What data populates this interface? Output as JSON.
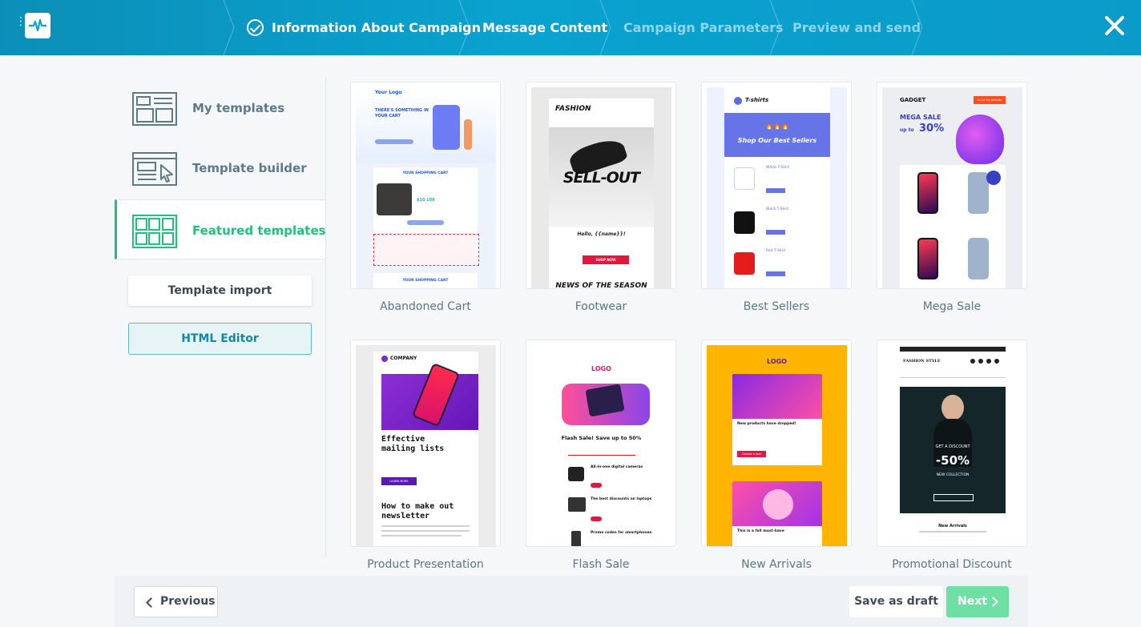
{
  "header": {
    "steps": [
      {
        "label": "Information About Campaign",
        "state": "done"
      },
      {
        "label": "Message Content",
        "state": "current"
      },
      {
        "label": "Campaign Parameters",
        "state": "future"
      },
      {
        "label": "Preview and send",
        "state": "future"
      }
    ]
  },
  "sidebar": {
    "items": [
      {
        "label": "My templates"
      },
      {
        "label": "Template builder"
      },
      {
        "label": "Featured templates"
      }
    ],
    "import_label": "Template import",
    "html_editor_label": "HTML Editor"
  },
  "templates": [
    {
      "name": "Abandoned Cart",
      "thumb": {
        "logo": "Your Logo",
        "headline": "THERE'S SOMETHING IN YOUR CART",
        "section": "YOUR SHOPPING CART",
        "price": "$10 109",
        "footer_section": "YOUR SHOPPING CART"
      }
    },
    {
      "name": "Footwear",
      "thumb": {
        "brand": "FASHION",
        "hero": "SELL-OUT",
        "greeting": "Hello, {{name}}!",
        "cta": "SHOP NOW",
        "bottom": "NEWS OF THE SEASON"
      }
    },
    {
      "name": "Best Sellers",
      "thumb": {
        "brand": "T-shirts",
        "emoji": "🔥🔥🔥",
        "banner": "Shop Our Best Sellers",
        "items": [
          "White T-Shirt",
          "Black T-Shirt",
          "Red T-Shirt"
        ]
      }
    },
    {
      "name": "Mega Sale",
      "thumb": {
        "brand": "GADGET",
        "button": "Go to the website",
        "headline": "MEGA SALE",
        "sub": "up to",
        "percent": "30%"
      }
    },
    {
      "name": "Product Presentation",
      "thumb": {
        "brand": "COMPANY",
        "headline1": "Effective mailing lists",
        "cta": "LEARN MORE",
        "headline2": "How to make out newsletter"
      }
    },
    {
      "name": "Flash Sale",
      "thumb": {
        "logo": "LOGO",
        "headline": "Flash Sale! Save up to 50%",
        "items": [
          "All-in-one digital cameras",
          "The best discounts on laptops",
          "Promo codes for smartphones"
        ]
      }
    },
    {
      "name": "New Arrivals",
      "thumb": {
        "logo": "LOGO",
        "headline1": "New products have dropped!",
        "cta": "Choose a look",
        "headline2": "This is a fall must-have"
      }
    },
    {
      "name": "Promotional Discount",
      "thumb": {
        "brand": "FASHION STYLE",
        "line1": "GET A DISCOUNT",
        "percent": "-50%",
        "line2": "NEW COLLECTION",
        "bottom": "New Arrivals"
      }
    }
  ],
  "footer": {
    "previous_label": "Previous",
    "draft_label": "Save as draft",
    "next_label": "Next"
  },
  "colors": {
    "header": "#0aa2cf",
    "accent_green": "#1dc37a",
    "next_button": "#6fe0a4",
    "html_editor_bg": "#e6f4f6"
  }
}
